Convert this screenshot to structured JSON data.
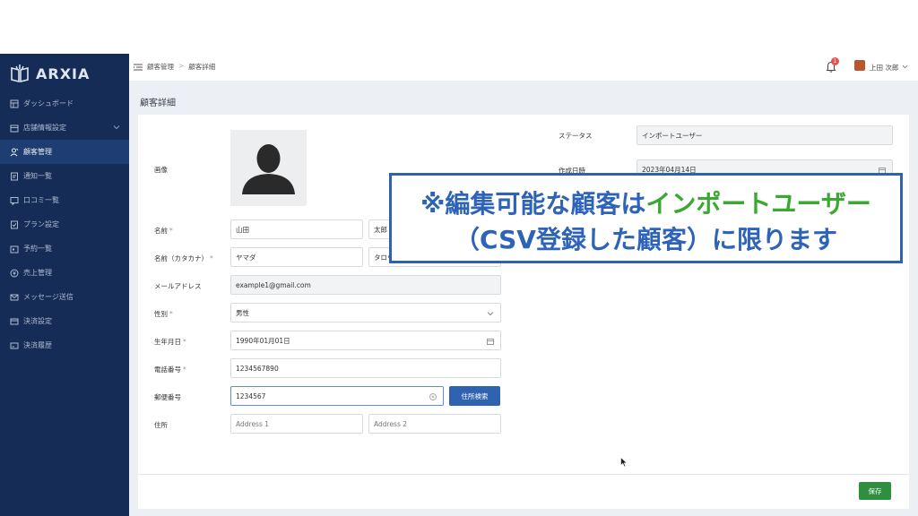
{
  "app": {
    "name": "ARXIA"
  },
  "sidebar": {
    "items": [
      {
        "label": "ダッシュボード",
        "icon": "dashboard-icon"
      },
      {
        "label": "店舗情報設定",
        "icon": "store-icon",
        "expandable": true
      },
      {
        "label": "顧客管理",
        "icon": "user-icon",
        "active": true
      },
      {
        "label": "通知一覧",
        "icon": "notice-icon"
      },
      {
        "label": "口コミ一覧",
        "icon": "review-icon"
      },
      {
        "label": "プラン設定",
        "icon": "plan-icon"
      },
      {
        "label": "予約一覧",
        "icon": "calendar-icon"
      },
      {
        "label": "売上管理",
        "icon": "sales-icon"
      },
      {
        "label": "メッセージ送信",
        "icon": "mail-icon"
      },
      {
        "label": "決済設定",
        "icon": "payment-icon"
      },
      {
        "label": "決済履歴",
        "icon": "history-icon"
      }
    ]
  },
  "header": {
    "breadcrumb": [
      "顧客管理",
      "顧客詳細"
    ],
    "notification_count": "1",
    "user_name": "上田 次郎"
  },
  "page": {
    "title": "顧客詳細"
  },
  "form": {
    "image_label": "画像",
    "name_label": "名前",
    "name_kana_label": "名前（カタカナ）",
    "email_label": "メールアドレス",
    "gender_label": "性別",
    "birthday_label": "生年月日",
    "phone_label": "電話番号",
    "postal_label": "郵便番号",
    "address_label": "住所",
    "required_mark": "*",
    "last_name": "山田",
    "first_name": "太郎",
    "last_name_kana": "ヤマダ",
    "first_name_kana": "タロウ",
    "email": "example1@gmail.com",
    "gender": "男性",
    "birthday": "1990年01月01日",
    "phone": "1234567890",
    "postal": "1234567",
    "address_search_label": "住所検索",
    "address1_placeholder": "Address 1",
    "address2_placeholder": "Address 2",
    "status_label": "ステータス",
    "status_value": "インポートユーザー",
    "created_label": "作成日時",
    "created_value": "2023年04月14日"
  },
  "footer": {
    "save_label": "保存"
  },
  "overlay": {
    "line1_prefix": "※編集可能な顧客は",
    "line1_highlight": "インポートユーザー",
    "line2": "（CSV登録した顧客）に限ります"
  },
  "colors": {
    "sidebar": "#152c57",
    "accent": "#2f63b0",
    "save": "#2e8f3e",
    "overlay_blue": "#2d63b8",
    "overlay_green": "#3aa832"
  }
}
